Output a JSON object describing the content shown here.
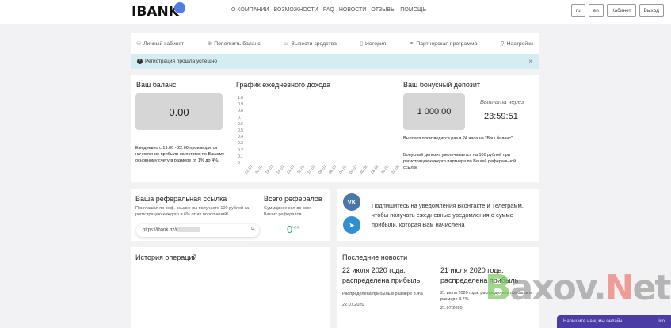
{
  "header": {
    "logo": "IBANK",
    "nav": [
      "О КОМПАНИИ",
      "ВОЗМОЖНОСТИ",
      "FAQ",
      "НОВОСТИ",
      "ОТЗЫВЫ",
      "ПОМОЩЬ"
    ],
    "buttons": [
      "ru",
      "en",
      "Кабинет",
      "Выход"
    ]
  },
  "menu": [
    {
      "icon": "user-icon",
      "label": "Личный кабинет"
    },
    {
      "icon": "plus-circle-icon",
      "label": "Пополнить баланс"
    },
    {
      "icon": "wallet-icon",
      "label": "Вывести средства"
    },
    {
      "icon": "history-icon",
      "label": "История"
    },
    {
      "icon": "handshake-icon",
      "label": "Партнерская программа"
    },
    {
      "icon": "wrench-icon",
      "label": "Настройки"
    }
  ],
  "alert": {
    "text": "Регистрация прошла успешно",
    "close": "×"
  },
  "balance": {
    "title": "Ваш баланс",
    "value": "0.00",
    "note": "Ежедневно с 19:00 - 22:00 производится начисление прибыли на остаток по Вашему основному счету в размере от 1% до 4%."
  },
  "chart_data": {
    "type": "line",
    "title": "График ежедневного дохода",
    "ylim": [
      0,
      1
    ],
    "yticks": [
      "0",
      "0.1",
      "0.2",
      "0.3",
      "0.4",
      "0.5",
      "0.6",
      "0.7",
      "0.8",
      "0.9",
      "1.0"
    ],
    "categories": [
      "22.07",
      "20.07",
      "18.07",
      "16.07",
      "14.07",
      "12.07",
      "10.07",
      "08.07",
      "06.07",
      "04.07",
      "02.07",
      "30.06",
      "28.06",
      "26.06",
      "24.06"
    ],
    "series": []
  },
  "bonus": {
    "title": "Ваш бонусный депозит",
    "value": "1 000.00",
    "payout_label": "Выплата через",
    "timer": "23:59:51",
    "note1": "Выплата производится раз в 24 часа на \"Ваш баланс\"",
    "note2": "Бонусный депозит увеличивается на 100 рублей при регистрации каждого партнера по Вашей реферальной ссылке"
  },
  "referral": {
    "title": "Ваша реферальная ссылка",
    "desc": "Приглашая по реф. ссылке вы получаете 100 рублей за регистрацию каждого и 6% от их пополнений!",
    "link": "https://ibank.bz/r",
    "total_title": "Всего рефералов",
    "total_desc": "Суммарное кол-во всех Ваших рефералов",
    "total_value": "0",
    "total_unit": "чел."
  },
  "subscribe": {
    "text": "Подпишитесь на уведомления Вконтакте и Телеграмм, чтобы получать ежедневные уведомления о сумме прибыли, которая Вам начислена",
    "vk": "VK",
    "colors": {
      "vk": "#4a76a8",
      "telegram": "#2f8fd0"
    }
  },
  "history": {
    "title": "История операций"
  },
  "news": {
    "title": "Последние новости",
    "items": [
      {
        "headline": "22 июля 2020 года: распределена прибыль",
        "text": "Распределена прибыль в размере 3.4%",
        "date": "22.07.2020"
      },
      {
        "headline": "21 июля 2020 года: распределена прибыль",
        "text": "21 июля 2020 года: распределена прибыль в размере 3.7%",
        "date": "21.07.2020"
      }
    ]
  },
  "watermark": "Baxov.Net",
  "chat": {
    "text": "Напишите нам, мы онлайн!",
    "brand": "jivo"
  }
}
